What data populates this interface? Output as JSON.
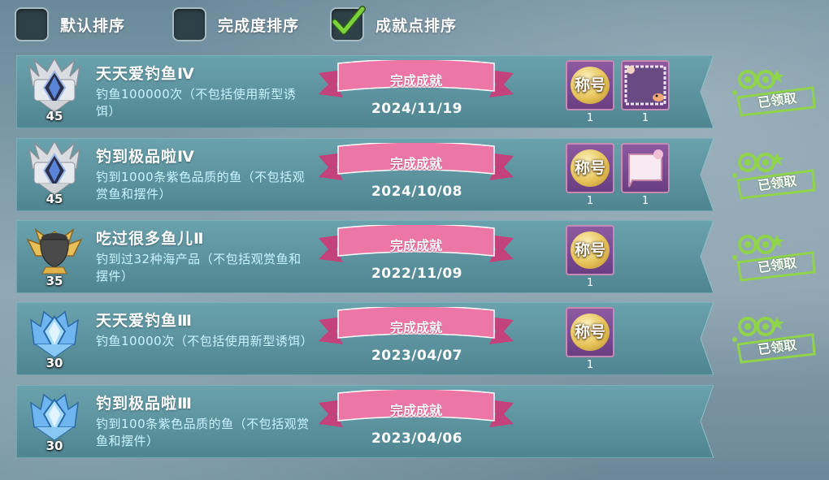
{
  "sort_options": [
    {
      "label": "默认排序",
      "checked": false
    },
    {
      "label": "完成度排序",
      "checked": false
    },
    {
      "label": "成就点排序",
      "checked": true
    }
  ],
  "ribbon_label": "完成成就",
  "claimed_label": "已领取",
  "title_reward_label": "称号",
  "colors": {
    "row_bg": "#5b8f9c",
    "desc_text": "#c8f4ff",
    "ribbon": "#e8689a",
    "claim_green": "#8fd44a",
    "checkmark": "#7bd23c"
  },
  "achievements": [
    {
      "title": "天天爱钓鱼Ⅳ",
      "desc": "钓鱼100000次（不包括使用新型诱饵）",
      "points": "45",
      "badge": "silver-crown-badge",
      "date": "2024/11/19",
      "rewards": [
        {
          "type": "title",
          "count": "1"
        },
        {
          "type": "frame",
          "count": "1"
        }
      ],
      "claimed": true
    },
    {
      "title": "钓到极品啦Ⅳ",
      "desc": "钓到1000条紫色品质的鱼（不包括观赏鱼和摆件）",
      "points": "45",
      "badge": "silver-crown-badge",
      "date": "2024/10/08",
      "rewards": [
        {
          "type": "title",
          "count": "1"
        },
        {
          "type": "bubble",
          "count": "1"
        }
      ],
      "claimed": true
    },
    {
      "title": "吃过很多鱼儿Ⅱ",
      "desc": "钓到过32种海产品（不包括观赏鱼和摆件）",
      "points": "35",
      "badge": "gold-urn-badge",
      "date": "2022/11/09",
      "rewards": [
        {
          "type": "title",
          "count": "1"
        }
      ],
      "claimed": true
    },
    {
      "title": "天天爱钓鱼Ⅲ",
      "desc": "钓鱼10000次（不包括使用新型诱饵）",
      "points": "30",
      "badge": "blue-crystal-badge",
      "date": "2023/04/07",
      "rewards": [
        {
          "type": "title",
          "count": "1"
        }
      ],
      "claimed": true
    },
    {
      "title": "钓到极品啦Ⅲ",
      "desc": "钓到100条紫色品质的鱼（不包括观赏鱼和摆件）",
      "points": "30",
      "badge": "blue-crystal-badge",
      "date": "2023/04/06",
      "rewards": [],
      "claimed": false
    }
  ]
}
